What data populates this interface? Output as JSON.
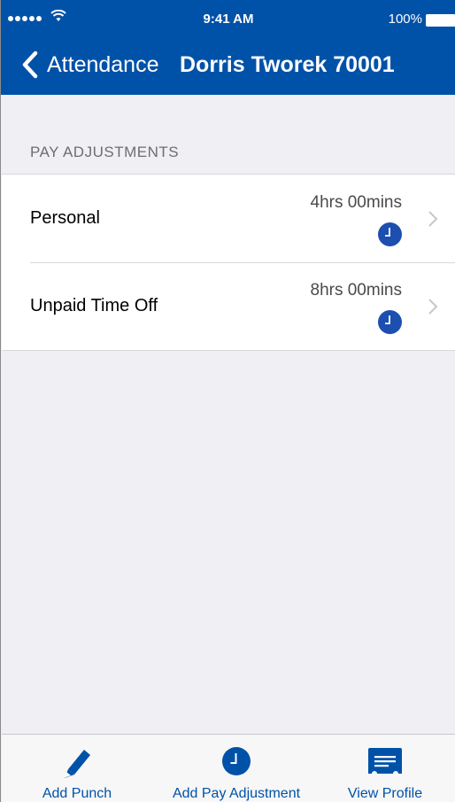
{
  "status_bar": {
    "time": "9:41 AM",
    "battery_percent": "100%"
  },
  "nav": {
    "back_label": "Attendance",
    "title": "Dorris Tworek 70001"
  },
  "section": {
    "header": "PAY ADJUSTMENTS",
    "items": [
      {
        "label": "Personal",
        "value": "4hrs 00mins",
        "icon": "clock-icon"
      },
      {
        "label": "Unpaid Time Off",
        "value": "8hrs 00mins",
        "icon": "clock-icon"
      }
    ]
  },
  "tabbar": {
    "tabs": [
      {
        "label": "Add Punch",
        "icon": "pencil-icon"
      },
      {
        "label": "Add Pay Adjustment",
        "icon": "clock-icon"
      },
      {
        "label": "View Profile",
        "icon": "profile-card-icon"
      }
    ]
  },
  "colors": {
    "brand": "#0052a8",
    "clock": "#1c4fb0",
    "background": "#efeff4"
  }
}
